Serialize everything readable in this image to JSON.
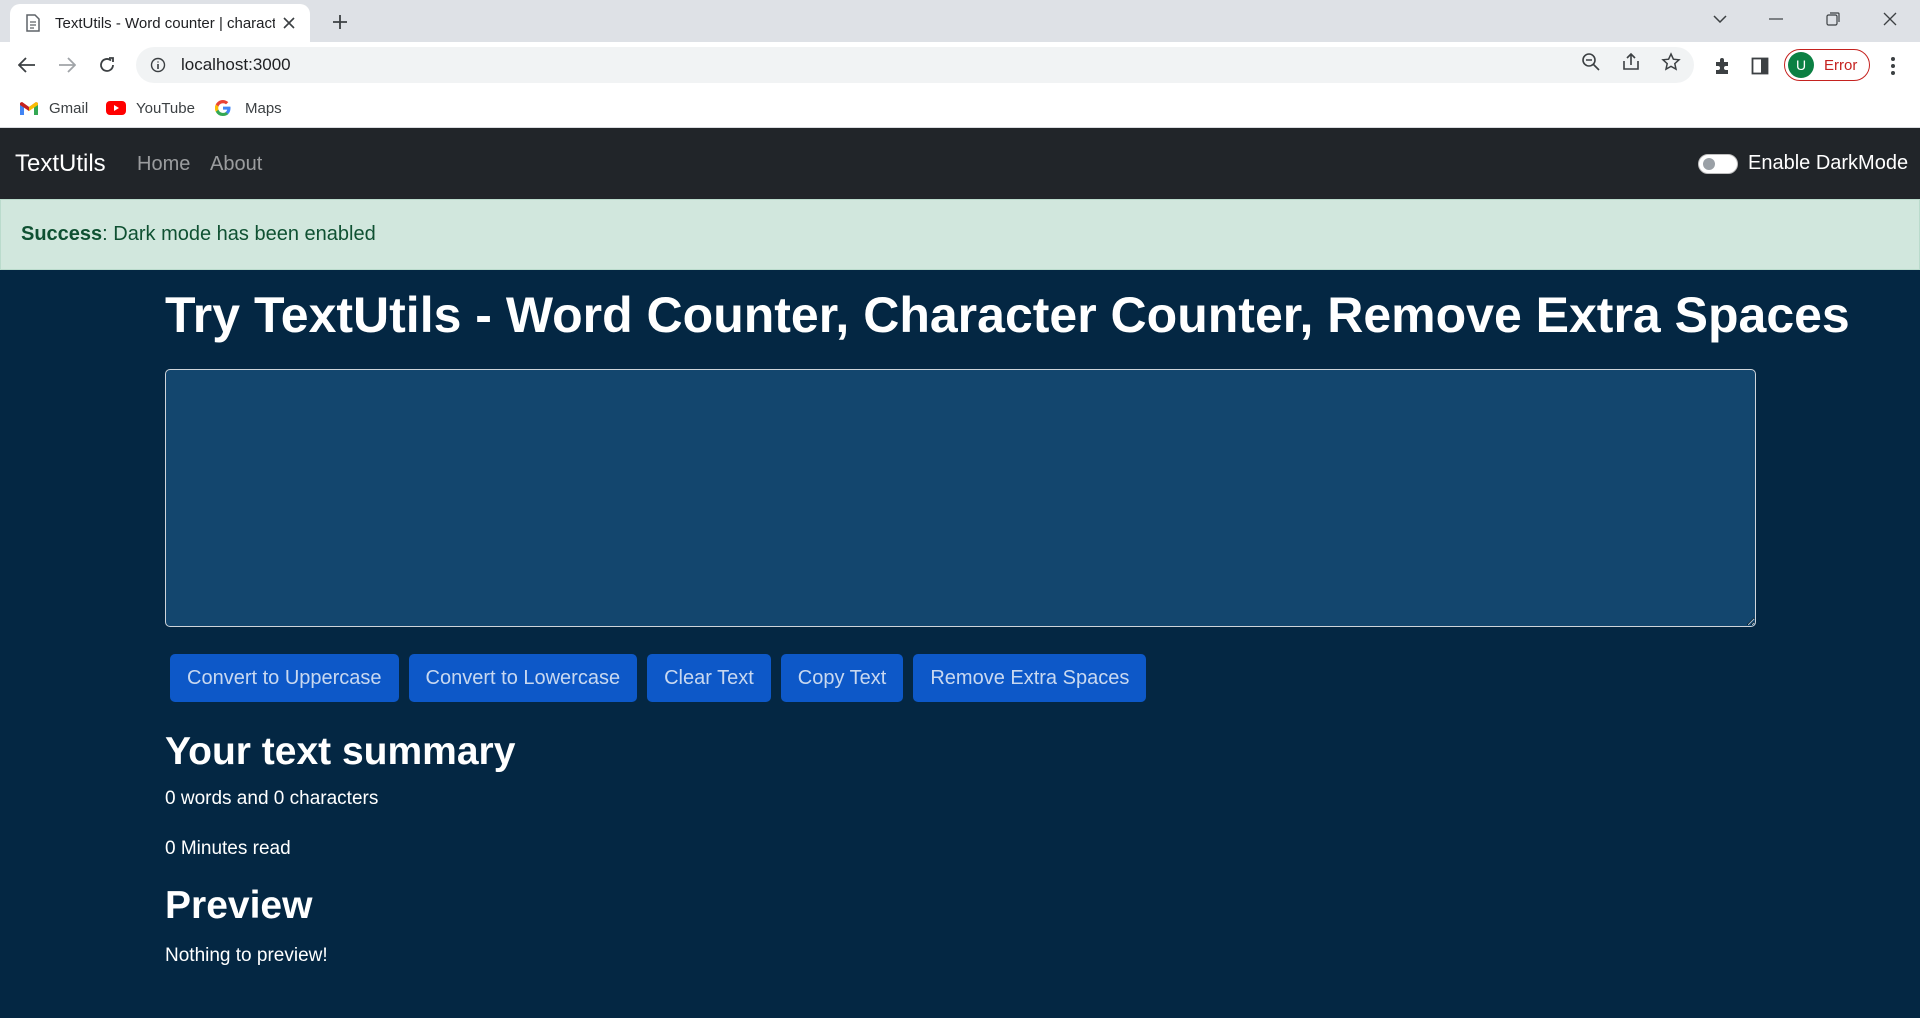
{
  "browser": {
    "tab_title": "TextUtils - Word counter | character counter",
    "url": "localhost:3000",
    "profile_initial": "U",
    "profile_label": "Error",
    "bookmarks": [
      {
        "label": "Gmail",
        "icon": "gmail-icon"
      },
      {
        "label": "YouTube",
        "icon": "youtube-icon"
      },
      {
        "label": "Maps",
        "icon": "google-icon"
      }
    ]
  },
  "navbar": {
    "brand": "TextUtils",
    "links": [
      "Home",
      "About"
    ],
    "toggle_label": "Enable DarkMode",
    "toggle_on": false
  },
  "alert": {
    "strong": "Success",
    "message": ": Dark mode has been enabled"
  },
  "main": {
    "title": "Try TextUtils - Word Counter, Character Counter, Remove Extra Spaces",
    "textarea_value": "",
    "buttons": [
      "Convert to Uppercase",
      "Convert to Lowercase",
      "Clear Text",
      "Copy Text",
      "Remove Extra Spaces"
    ],
    "summary_heading": "Your text summary",
    "summary_counts": "0 words and 0 characters",
    "summary_read": "0 Minutes read",
    "preview_heading": "Preview",
    "preview_text": "Nothing to preview!"
  },
  "colors": {
    "page_bg": "#042743",
    "navbar_bg": "#212529",
    "alert_bg": "#d1e7dd",
    "textarea_bg": "#13466e",
    "button_bg": "#0d58c8"
  }
}
